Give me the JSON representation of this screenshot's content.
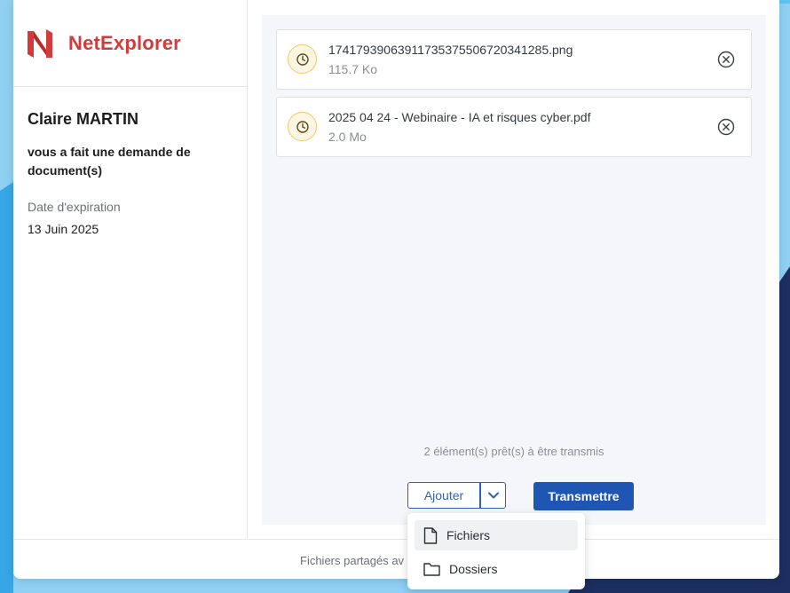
{
  "brand": {
    "name": "NetExplorer",
    "color": "#d23b3b"
  },
  "requester": {
    "name": "Claire MARTIN",
    "message": "vous a fait une demande de document(s)",
    "expiration_label": "Date d'expiration",
    "expiration_value": "13 Juin 2025"
  },
  "files": [
    {
      "name": "17417939063911735375506720341285.png",
      "size": "115.7 Ko",
      "status_icon": "clock-icon"
    },
    {
      "name": "2025 04 24 - Webinaire - IA et risques cyber.pdf",
      "size": "2.0 Mo",
      "status_icon": "clock-icon"
    }
  ],
  "status_text": "2 élément(s) prêt(s) à être transmis",
  "actions": {
    "add_label": "Ajouter",
    "send_label": "Transmettre"
  },
  "add_menu": {
    "items": [
      {
        "label": "Fichiers",
        "icon": "file-icon"
      },
      {
        "label": "Dossiers",
        "icon": "folder-icon"
      }
    ]
  },
  "footer": {
    "text": "Fichiers partagés av"
  },
  "colors": {
    "accent": "#1f55b3",
    "pending": "#efc86a",
    "background_light": "#8fd0f3",
    "background_dark": "#1c2f5e"
  }
}
